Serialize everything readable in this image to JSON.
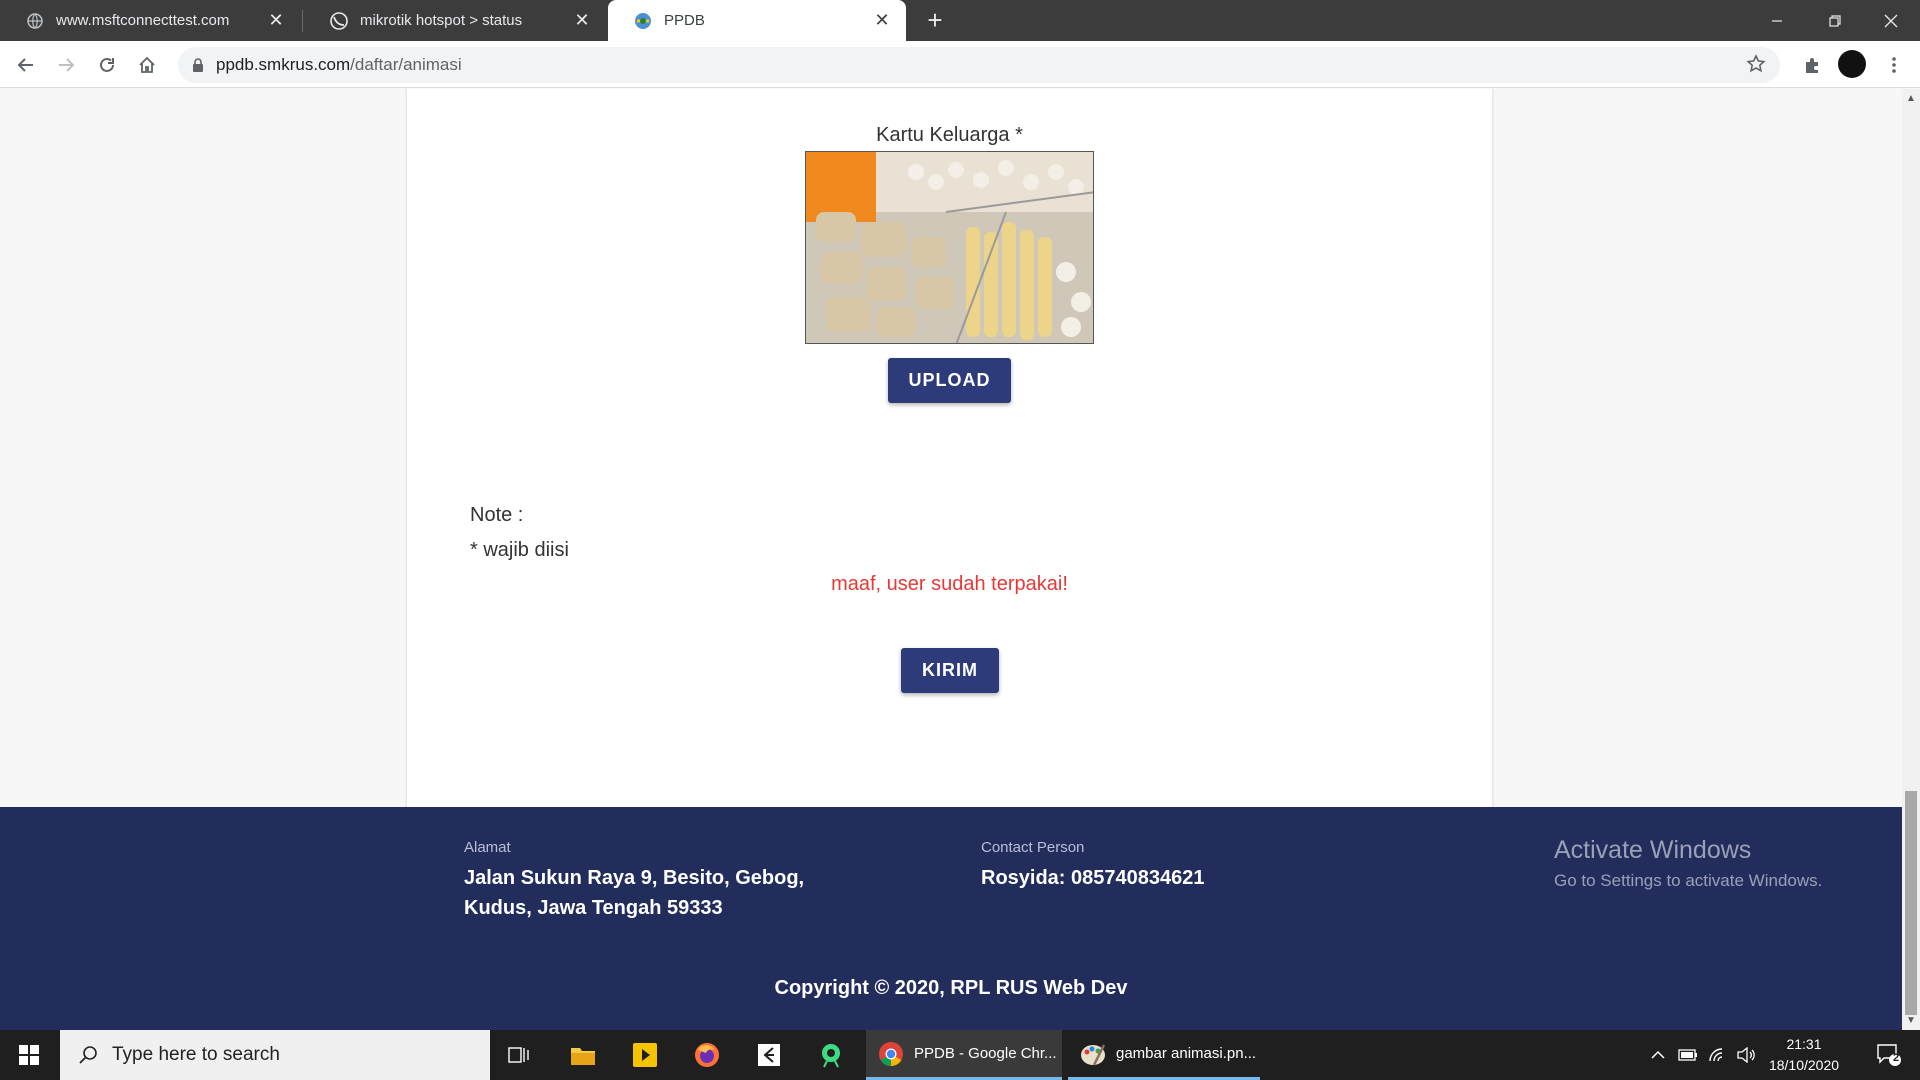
{
  "browser": {
    "tabs": [
      {
        "title": "www.msftconnecttest.com",
        "icon": "globe-icon",
        "active": false
      },
      {
        "title": "mikrotik hotspot > status",
        "icon": "mikrotik-icon",
        "active": false
      },
      {
        "title": "PPDB",
        "icon": "ppdb-logo-icon",
        "active": true
      }
    ],
    "close_glyph": "✕",
    "new_tab_glyph": "+",
    "url_host": "ppdb.smkrus.com",
    "url_path": "/daftar/animasi"
  },
  "form": {
    "document_label": "Kartu Keluarga *",
    "upload_label": "UPLOAD",
    "note_title": "Note :",
    "note_required": "* wajib diisi",
    "error_message": "maaf, user sudah terpakai!",
    "submit_label": "KIRIM",
    "error_color": "#e53935",
    "button_color": "#2d3b7a"
  },
  "footer": {
    "address_label": "Alamat",
    "address_line1": "Jalan Sukun Raya 9, Besito, Gebog,",
    "address_line2": "Kudus, Jawa Tengah 59333",
    "contact_label": "Contact Person",
    "contact_value": "Rosyida: 085740834621",
    "copyright": "Copyright © 2020, RPL RUS Web Dev",
    "background_color": "#232d5c"
  },
  "watermark": {
    "line1": "Activate Windows",
    "line2": "Go to Settings to activate Windows."
  },
  "taskbar": {
    "search_placeholder": "Type here to search",
    "apps": [
      {
        "label": "PPDB - Google Chr...",
        "icon": "chrome-icon",
        "active": true
      },
      {
        "label": "gambar animasi.pn...",
        "icon": "paint-icon",
        "active": false
      }
    ],
    "time": "21:31",
    "date": "18/10/2020",
    "notification_count": "2"
  }
}
